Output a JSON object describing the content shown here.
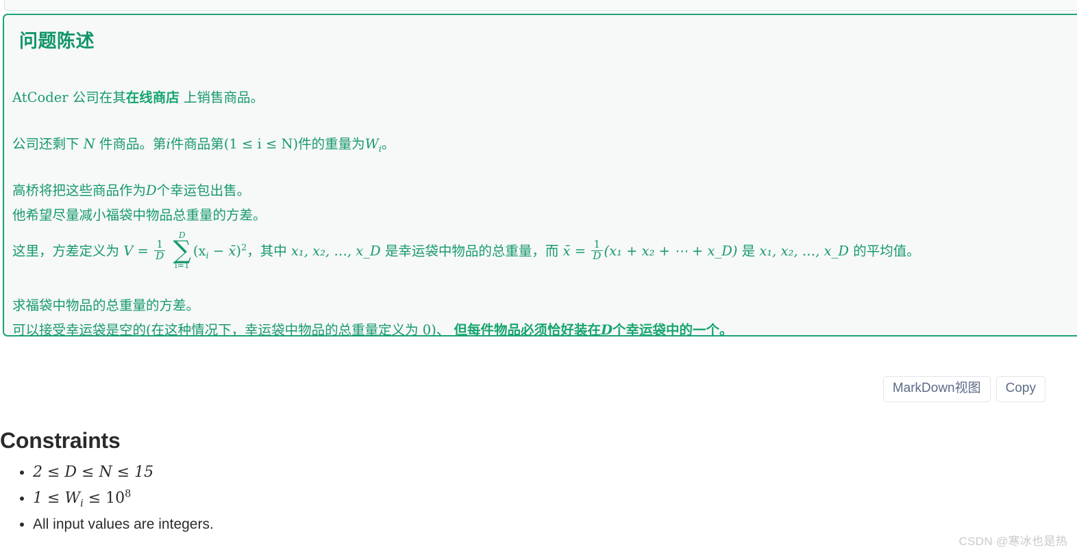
{
  "panel": {
    "collapse_icon": "double-chevron-up-icon"
  },
  "statement": {
    "title": "问题陈述",
    "accent_color": "#1aa179",
    "text_color": "#17996f",
    "background": "#f7f8f8",
    "paragraphs": {
      "p1_pre": "AtCoder 公司在其",
      "p1_bold": "在线商店",
      "p1_post": "上销售商品。",
      "p2_a": "公司还剩下",
      "p2_N": "N",
      "p2_b": "件商品。第",
      "p2_i": "i",
      "p2_c": "件商品第",
      "p2_range": "(1 ≤ i ≤ N)",
      "p2_d": "件的重量为",
      "p2_W": "W",
      "p2_Wsub": "i",
      "p2_e": "。",
      "p3_a": "高桥将把这些商品作为",
      "p3_D": "D",
      "p3_b": "个幸运包出售。",
      "p4": "他希望尽量减小福袋中物品总重量的方差。",
      "p5_a": "这里，方差定义为",
      "p5_V": "V",
      "p5_eq": "=",
      "p5_frac_num": "1",
      "p5_frac_den": "D",
      "p5_sum_top": "D",
      "p5_sum_bot": "i=1",
      "p5_sum_sym": "∑",
      "p5_body": "(x",
      "p5_body_sub": "i",
      "p5_minus": "−",
      "p5_xbar": "x̄",
      "p5_close": ")",
      "p5_pow": "2",
      "p5_b": "，其中",
      "p5_list1": "x₁, x₂, …, x_D",
      "p5_c": "是幸运袋中物品的总重量，而",
      "p5_xbar2": "x̄",
      "p5_eq2": "=",
      "p5_frac2_num": "1",
      "p5_frac2_den": "D",
      "p5_paren": "(x₁ + x₂ + ⋯ + x_D)",
      "p5_d": "是",
      "p5_list2": "x₁, x₂, …, x_D",
      "p5_e": "的平均值。",
      "p6": "求福袋中物品的总重量的方差。",
      "p7_a": "可以接受幸运袋是空的(在这种情况下，幸运袋中物品的总重量定义为 0)、",
      "p7_bold_pre": "但",
      "p7_bold_a": "每件物品必须恰好装在",
      "p7_bold_D": "D",
      "p7_bold_b": "个幸运袋中的一个",
      "p7_end": "。"
    }
  },
  "toolbar": {
    "markdown_view_label": "MarkDown视图",
    "copy_label": "Copy"
  },
  "constraints": {
    "title": "Constraints",
    "items": [
      {
        "type": "math",
        "text": "2 ≤ D ≤ N ≤ 15"
      },
      {
        "type": "math",
        "text": "1 ≤ W_i ≤ 10^8"
      },
      {
        "type": "plain",
        "text": "All input values are integers."
      }
    ]
  },
  "watermark": {
    "text": "CSDN @寒冰也是热"
  }
}
